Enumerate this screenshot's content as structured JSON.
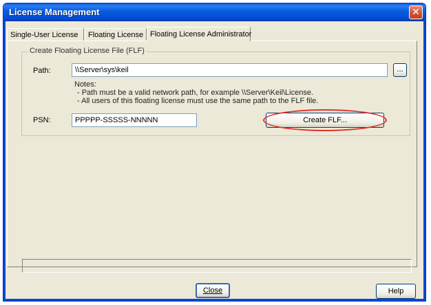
{
  "window": {
    "title": "License Management"
  },
  "tabs": [
    {
      "label": "Single-User License",
      "active": false
    },
    {
      "label": "Floating License",
      "active": false
    },
    {
      "label": "Floating License Administrator",
      "active": true
    }
  ],
  "group": {
    "label": "Create Floating License File (FLF)"
  },
  "path": {
    "label": "Path:",
    "value": "\\\\Server\\sys\\keil",
    "browse_label": "..."
  },
  "notes": {
    "heading": "Notes:",
    "line1": "- Path must be a valid network path, for example \\\\Server\\Keil\\License.",
    "line2": "- All users of this floating license must use the same path to the FLF file."
  },
  "psn": {
    "label": "PSN:",
    "value": "PPPPP-SSSSS-NNNNN"
  },
  "create_button": {
    "label": "Create FLF..."
  },
  "footer": {
    "close_label": "Close",
    "help_label": "Help"
  },
  "colors": {
    "titlebar": "#0449d1",
    "highlight_ellipse": "#e0332a",
    "dialog_bg": "#ece9d8"
  }
}
